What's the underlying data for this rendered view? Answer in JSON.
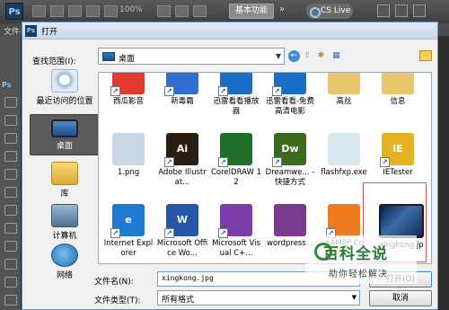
{
  "photoshop": {
    "logo": "Ps",
    "zoom": "100%",
    "workspace_button": "基本功能",
    "cs_live": "CS Live",
    "menu_first": "文件",
    "toolbox_ps": "Ps"
  },
  "dialog": {
    "title_icon": "Ps",
    "title": "打开",
    "look_in_label": "查找范围(I):",
    "look_in_value": "桌面",
    "places": [
      {
        "label": "最近访问的位置",
        "icon": "recent-places-icon"
      },
      {
        "label": "桌面",
        "icon": "desktop-icon"
      },
      {
        "label": "库",
        "icon": "library-icon"
      },
      {
        "label": "计算机",
        "icon": "computer-icon"
      },
      {
        "label": "网络",
        "icon": "network-icon"
      }
    ],
    "files": [
      {
        "label": "西瓜影音",
        "text": "",
        "color": "#e23b2e",
        "shortcut": true
      },
      {
        "label": "新毒霸",
        "text": "",
        "color": "#2f6fd1",
        "shortcut": true
      },
      {
        "label": "迅雷看看播放器",
        "text": "",
        "color": "#1a6ec6",
        "shortcut": true
      },
      {
        "label": "迅雷看看-免费高清电影",
        "text": "",
        "color": "#1a6ec6",
        "shortcut": true
      },
      {
        "label": "高丝",
        "text": "",
        "color": "#e9c66a",
        "shortcut": false
      },
      {
        "label": "信息",
        "text": "",
        "color": "#e9c66a",
        "shortcut": false
      },
      {
        "label": "1.png",
        "text": "",
        "color": "#c9d6e3",
        "shortcut": false
      },
      {
        "label": "Adobe Illustrat...",
        "text": "Ai",
        "color": "#2b1d0f",
        "shortcut": true
      },
      {
        "label": "CorelDRAW 12",
        "text": "",
        "color": "#1f6e2a",
        "shortcut": true
      },
      {
        "label": "Dreamwe... - 快捷方式",
        "text": "Dw",
        "color": "#3a6a1e",
        "shortcut": true
      },
      {
        "label": "flashfxp.exe",
        "text": "",
        "color": "#d8e6ef",
        "shortcut": false
      },
      {
        "label": "IETester",
        "text": "IE",
        "color": "#e3b21e",
        "shortcut": true
      },
      {
        "label": "Internet Explorer",
        "text": "e",
        "color": "#1e79d2",
        "shortcut": true
      },
      {
        "label": "Microsoft Office Wo...",
        "text": "W",
        "color": "#2755a8",
        "shortcut": true
      },
      {
        "label": "Microsoft Visual C+...",
        "text": "",
        "color": "#7a3da8",
        "shortcut": true
      },
      {
        "label": "wordpress...",
        "text": "",
        "color": "#7a3b8f",
        "shortcut": false
      },
      {
        "label": "XAMPP Cc",
        "text": "",
        "color": "#f07b1e",
        "shortcut": true
      },
      {
        "label": "xingkong.jp",
        "text": "",
        "color": "#0b1f46",
        "shortcut": false
      },
      {
        "label": "",
        "text": "",
        "color": "#e8b830",
        "shortcut": false
      },
      {
        "label": "",
        "text": "",
        "color": "#2c6fb6",
        "shortcut": false
      },
      {
        "label": "",
        "text": "",
        "color": "#1f86c9",
        "shortcut": false
      },
      {
        "label": "",
        "text": "",
        "color": "#1a8bd0",
        "shortcut": false
      }
    ],
    "filename_label": "文件名(N):",
    "filename_value": "xingkong.jpg",
    "filetype_label": "文件类型(T):",
    "filetype_value": "所有格式",
    "open_button": "打开(O)",
    "cancel_button": "取消"
  },
  "watermark": {
    "main": "百科全说",
    "sub": "助你轻松解决"
  }
}
